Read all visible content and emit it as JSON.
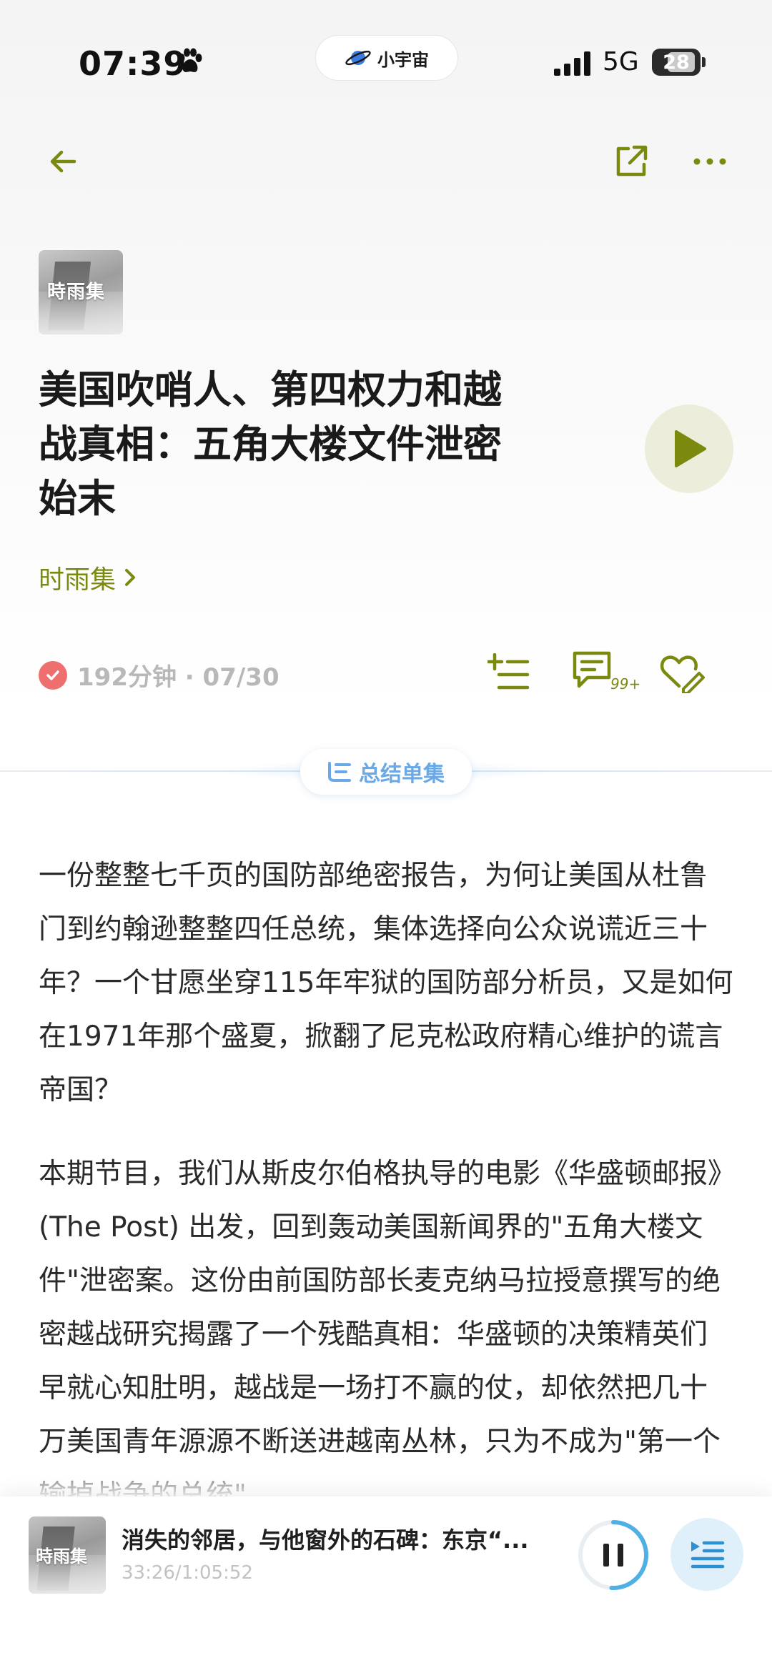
{
  "status_bar": {
    "time": "07:39",
    "island_label": "小宇宙",
    "network": "5G",
    "battery": "28"
  },
  "nav": {
    "icons": [
      "arrow-left-icon",
      "share-icon",
      "more-icon"
    ]
  },
  "episode": {
    "cover_text": "時雨集",
    "title": "美国吹哨人、第四权力和越战真相：五角大楼文件泄密始末",
    "podcast_name": "时雨集",
    "meta": "192分钟 · 07/30",
    "comments_count": "99+"
  },
  "summary": {
    "label": "总结单集",
    "paragraphs": [
      "一份整整七千页的国防部绝密报告，为何让美国从杜鲁门到约翰逊整整四任总统，集体选择向公众说谎近三十年？一个甘愿坐穿115年牢狱的国防部分析员，又是如何在1971年那个盛夏，掀翻了尼克松政府精心维护的谎言帝国？",
      "本期节目，我们从斯皮尔伯格执导的电影《华盛顿邮报》(The Post) 出发，回到轰动美国新闻界的\"五角大楼文件\"泄密案。这份由前国防部长麦克纳马拉授意撰写的绝密越战研究揭露了一个残酷真相：华盛顿的决策精英们早就心知肚明，越战是一场打不赢的仗，却依然把几十万美国青年源源不断送进越南丛林，只为不成为\"第一个输掉战争的总统\"。"
    ]
  },
  "player": {
    "cover_text": "時雨集",
    "title": "消失的邻居，与他窗外的石碑：东京“...",
    "time": "33:26/1:05:52",
    "progress": 0.508
  },
  "colors": {
    "accent": "#7b8a0f",
    "play_bg": "#ecedda",
    "summary_blue": "#6aa9e8",
    "player_ring": "#4fb0e6",
    "check_red": "#ef6f6f"
  }
}
